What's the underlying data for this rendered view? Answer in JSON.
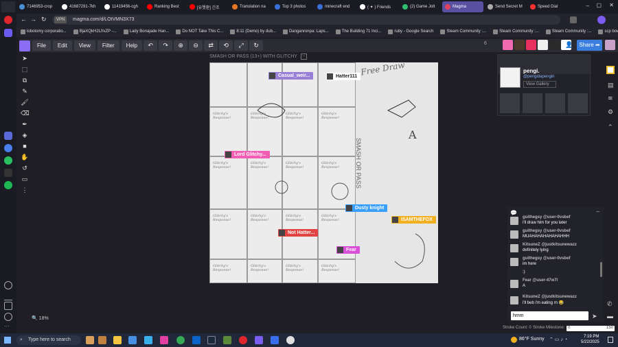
{
  "browser": {
    "tabs": [
      {
        "label": "7146953-crop",
        "color": "#4a8fd8"
      },
      {
        "label": "41687291-7kh",
        "color": "#ffffff"
      },
      {
        "label": "11419456-cgh",
        "color": "#ffffff"
      },
      {
        "label": "Ranking Best",
        "color": "#ff0000"
      },
      {
        "label": "[유챗환] 긴조",
        "color": "#ff0000"
      },
      {
        "label": "Translation na",
        "color": "#e87722"
      },
      {
        "label": "Top 3 photos",
        "color": "#3a6fd8"
      },
      {
        "label": "minecraft end",
        "color": "#3a6fd8"
      },
      {
        "label": "( ✦ ) Friends",
        "color": "#ffffff"
      },
      {
        "label": "(2) Game Jolt",
        "color": "#2fbf71"
      },
      {
        "label": "Magma",
        "color": "#e0435e",
        "active": true
      },
      {
        "label": "Send Secret M",
        "color": "#aaaaaa"
      },
      {
        "label": "Speed Dial",
        "color": "#ff3030"
      }
    ],
    "url": "magma.com/d/LOtVMN3X73",
    "vpn_label": "VPN",
    "bookmarks": [
      "lobotomy corporatio...",
      "BjaXQkH2Lf/vZP -...",
      "Lady Bonajade Han...",
      "Do NOT Take This C...",
      "8:11 (Demo) by dub...",
      "Danganronpa: Laps...",
      "The Building 71 Inci...",
      "ruby - Google Search",
      "Steam Community :...",
      "Steam Community :...",
      "Steam Community :...",
      "scp bow - Google S..."
    ]
  },
  "app": {
    "menu": [
      "File",
      "Edit",
      "View",
      "Filter",
      "Help"
    ],
    "toolbar_icons": [
      "undo-icon",
      "redo-icon",
      "zoom-in-icon",
      "zoom-out-icon",
      "flip-icon",
      "rotate-icon",
      "fullscreen-icon",
      "reset-icon"
    ],
    "user_count": "6",
    "share_label": "Share",
    "canvas_title": "SMASH OR PASS (13+) WITH GLITCHY",
    "zoom": "18%",
    "stroke_count": "Stroke Count: 0",
    "stroke_milestone": "Stroke Milestone:",
    "slider_min": "0",
    "slider_max": "150",
    "cell_text": "Glitchy's Response!",
    "side_labels": [
      "Free Draw",
      "SMASH OR PASS",
      "A"
    ]
  },
  "cursors": [
    {
      "name": "Casual_weir...",
      "color": "#9a7fd6"
    },
    {
      "name": "Hatter111",
      "color": "#ffffff"
    },
    {
      "name": "Lord Glitchy...",
      "color": "#f25eb4"
    },
    {
      "name": "Dusty knight",
      "color": "#3aa0ff"
    },
    {
      "name": "ISAMTHEFOX",
      "color": "#f0b020"
    },
    {
      "name": "Not Hatter...",
      "color": "#e24444"
    },
    {
      "name": "Fear",
      "color": "#d84fd8"
    }
  ],
  "profile": {
    "name": "pengi.",
    "handle": "@pengidapengin",
    "view_gallery": "View Gallery"
  },
  "chat": {
    "messages": [
      {
        "name": "guithegsy @user-0vsbef",
        "text": "i'll draw him for you later"
      },
      {
        "name": "guithegsy @user-0vsbef",
        "text": "MUAHAHAHAHAHAHHH"
      },
      {
        "name": "KitsuneZ @justkitsunewazz",
        "text": "definitely lying"
      },
      {
        "name": "guithegsy @user-0vsbef",
        "text": "im here"
      },
      {
        "name": "",
        "text": ":)"
      },
      {
        "name": "Fear @user-47w7l",
        "text": "A"
      },
      {
        "name": "KitsuneZ @justkitsunewazz",
        "text": "i'll beb i'm eating rn 😂"
      }
    ],
    "input_value": "hmm"
  },
  "taskbar": {
    "search_placeholder": "Type here to search",
    "weather": "86°F  Sunny",
    "time": "7:19 PM",
    "date": "5/22/2025"
  }
}
